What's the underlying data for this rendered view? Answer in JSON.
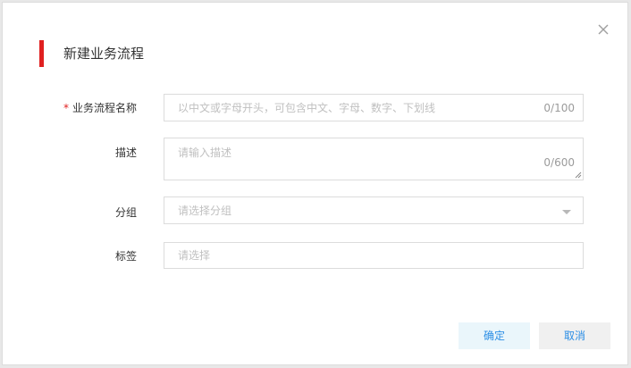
{
  "dialog": {
    "title": "新建业务流程",
    "close_icon": "close-icon"
  },
  "form": {
    "name": {
      "required_mark": "*",
      "label": "业务流程名称",
      "placeholder": "以中文或字母开头，可包含中文、字母、数字、下划线",
      "counter": "0/100"
    },
    "description": {
      "label": "描述",
      "placeholder": "请输入描述",
      "counter": "0/600"
    },
    "group": {
      "label": "分组",
      "placeholder": "请选择分组",
      "dropdown_icon": "chevron-down-icon"
    },
    "tags": {
      "label": "标签",
      "placeholder": "请选择"
    }
  },
  "buttons": {
    "confirm": "确定",
    "cancel": "取消"
  },
  "colors": {
    "accent_red": "#e02020",
    "link_blue": "#2b8ee5",
    "confirm_bg": "#eaf6fb",
    "cancel_bg": "#f0f0f0"
  }
}
